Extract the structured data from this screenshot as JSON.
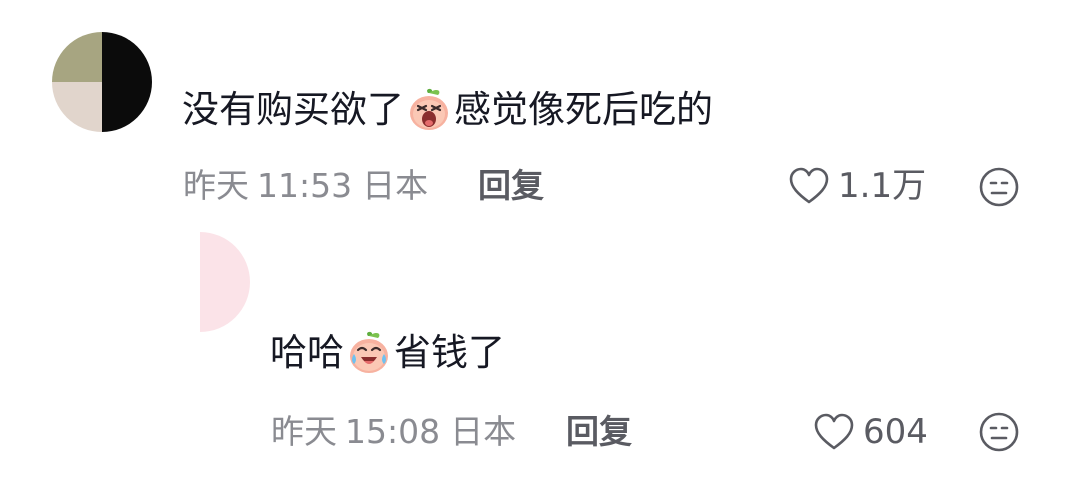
{
  "comments": [
    {
      "text_before": "没有购买欲了",
      "emoji": "angry-peach-emoji",
      "text_after": "感觉像死后吃的",
      "date": "昨天",
      "time": "11:53",
      "region": "日本",
      "reply_label": "回复",
      "likes": "1.1万",
      "like_icon": "heart-outline-icon",
      "dislike_icon": "meh-face-icon"
    },
    {
      "text_before": "哈哈",
      "emoji": "laugh-cry-peach-emoji",
      "text_after": "省钱了",
      "date": "昨天",
      "time": "15:08",
      "region": "日本",
      "reply_label": "回复",
      "likes": "604",
      "like_icon": "heart-outline-icon",
      "dislike_icon": "meh-face-icon"
    }
  ],
  "colors": {
    "text": "#161823",
    "meta": "#8a8b91",
    "action": "#5a5b62",
    "avatar_olive": "#a7a581",
    "avatar_black": "#0b0b0b",
    "avatar_beige": "#e1d5cc",
    "reply_avatar": "#fbe3e8"
  }
}
